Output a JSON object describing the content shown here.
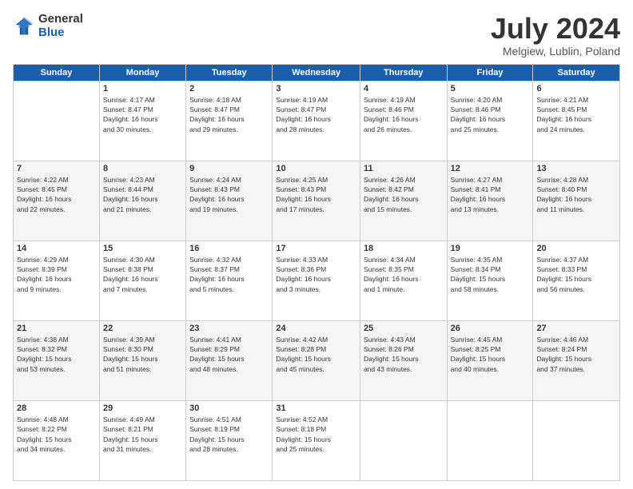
{
  "logo": {
    "general": "General",
    "blue": "Blue"
  },
  "header": {
    "title": "July 2024",
    "subtitle": "Melgiew, Lublin, Poland"
  },
  "columns": [
    "Sunday",
    "Monday",
    "Tuesday",
    "Wednesday",
    "Thursday",
    "Friday",
    "Saturday"
  ],
  "weeks": [
    [
      {
        "day": "",
        "info": ""
      },
      {
        "day": "1",
        "info": "Sunrise: 4:17 AM\nSunset: 8:47 PM\nDaylight: 16 hours\nand 30 minutes."
      },
      {
        "day": "2",
        "info": "Sunrise: 4:18 AM\nSunset: 8:47 PM\nDaylight: 16 hours\nand 29 minutes."
      },
      {
        "day": "3",
        "info": "Sunrise: 4:19 AM\nSunset: 8:47 PM\nDaylight: 16 hours\nand 28 minutes."
      },
      {
        "day": "4",
        "info": "Sunrise: 4:19 AM\nSunset: 8:46 PM\nDaylight: 16 hours\nand 26 minutes."
      },
      {
        "day": "5",
        "info": "Sunrise: 4:20 AM\nSunset: 8:46 PM\nDaylight: 16 hours\nand 25 minutes."
      },
      {
        "day": "6",
        "info": "Sunrise: 4:21 AM\nSunset: 8:45 PM\nDaylight: 16 hours\nand 24 minutes."
      }
    ],
    [
      {
        "day": "7",
        "info": "Sunrise: 4:22 AM\nSunset: 8:45 PM\nDaylight: 16 hours\nand 22 minutes."
      },
      {
        "day": "8",
        "info": "Sunrise: 4:23 AM\nSunset: 8:44 PM\nDaylight: 16 hours\nand 21 minutes."
      },
      {
        "day": "9",
        "info": "Sunrise: 4:24 AM\nSunset: 8:43 PM\nDaylight: 16 hours\nand 19 minutes."
      },
      {
        "day": "10",
        "info": "Sunrise: 4:25 AM\nSunset: 8:43 PM\nDaylight: 16 hours\nand 17 minutes."
      },
      {
        "day": "11",
        "info": "Sunrise: 4:26 AM\nSunset: 8:42 PM\nDaylight: 16 hours\nand 15 minutes."
      },
      {
        "day": "12",
        "info": "Sunrise: 4:27 AM\nSunset: 8:41 PM\nDaylight: 16 hours\nand 13 minutes."
      },
      {
        "day": "13",
        "info": "Sunrise: 4:28 AM\nSunset: 8:40 PM\nDaylight: 16 hours\nand 11 minutes."
      }
    ],
    [
      {
        "day": "14",
        "info": "Sunrise: 4:29 AM\nSunset: 8:39 PM\nDaylight: 16 hours\nand 9 minutes."
      },
      {
        "day": "15",
        "info": "Sunrise: 4:30 AM\nSunset: 8:38 PM\nDaylight: 16 hours\nand 7 minutes."
      },
      {
        "day": "16",
        "info": "Sunrise: 4:32 AM\nSunset: 8:37 PM\nDaylight: 16 hours\nand 5 minutes."
      },
      {
        "day": "17",
        "info": "Sunrise: 4:33 AM\nSunset: 8:36 PM\nDaylight: 16 hours\nand 3 minutes."
      },
      {
        "day": "18",
        "info": "Sunrise: 4:34 AM\nSunset: 8:35 PM\nDaylight: 16 hours\nand 1 minute."
      },
      {
        "day": "19",
        "info": "Sunrise: 4:35 AM\nSunset: 8:34 PM\nDaylight: 15 hours\nand 58 minutes."
      },
      {
        "day": "20",
        "info": "Sunrise: 4:37 AM\nSunset: 8:33 PM\nDaylight: 15 hours\nand 56 minutes."
      }
    ],
    [
      {
        "day": "21",
        "info": "Sunrise: 4:38 AM\nSunset: 8:32 PM\nDaylight: 15 hours\nand 53 minutes."
      },
      {
        "day": "22",
        "info": "Sunrise: 4:39 AM\nSunset: 8:30 PM\nDaylight: 15 hours\nand 51 minutes."
      },
      {
        "day": "23",
        "info": "Sunrise: 4:41 AM\nSunset: 8:29 PM\nDaylight: 15 hours\nand 48 minutes."
      },
      {
        "day": "24",
        "info": "Sunrise: 4:42 AM\nSunset: 8:28 PM\nDaylight: 15 hours\nand 45 minutes."
      },
      {
        "day": "25",
        "info": "Sunrise: 4:43 AM\nSunset: 8:26 PM\nDaylight: 15 hours\nand 43 minutes."
      },
      {
        "day": "26",
        "info": "Sunrise: 4:45 AM\nSunset: 8:25 PM\nDaylight: 15 hours\nand 40 minutes."
      },
      {
        "day": "27",
        "info": "Sunrise: 4:46 AM\nSunset: 8:24 PM\nDaylight: 15 hours\nand 37 minutes."
      }
    ],
    [
      {
        "day": "28",
        "info": "Sunrise: 4:48 AM\nSunset: 8:22 PM\nDaylight: 15 hours\nand 34 minutes."
      },
      {
        "day": "29",
        "info": "Sunrise: 4:49 AM\nSunset: 8:21 PM\nDaylight: 15 hours\nand 31 minutes."
      },
      {
        "day": "30",
        "info": "Sunrise: 4:51 AM\nSunset: 8:19 PM\nDaylight: 15 hours\nand 28 minutes."
      },
      {
        "day": "31",
        "info": "Sunrise: 4:52 AM\nSunset: 8:18 PM\nDaylight: 15 hours\nand 25 minutes."
      },
      {
        "day": "",
        "info": ""
      },
      {
        "day": "",
        "info": ""
      },
      {
        "day": "",
        "info": ""
      }
    ]
  ]
}
